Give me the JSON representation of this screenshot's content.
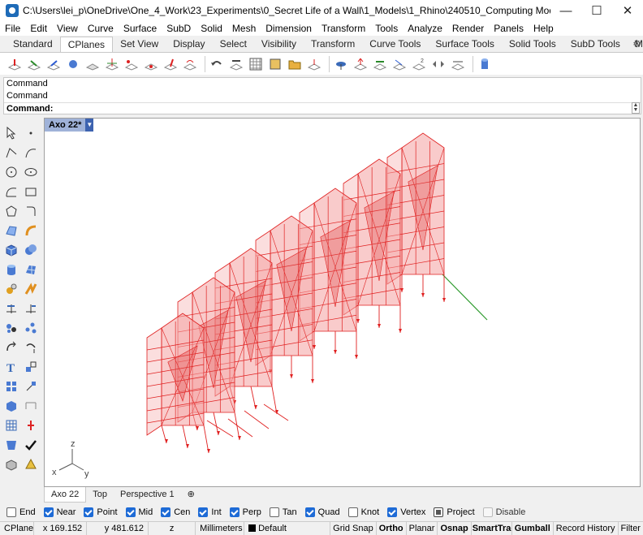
{
  "window": {
    "title": "C:\\Users\\lei_p\\OneDrive\\One_4_Work\\23_Experiments\\0_Secret Life of a Wall\\1_Models\\1_Rhino\\240510_Computing Module_Morphed Wall_...",
    "minimize": "—",
    "maximize": "☐",
    "close": "✕"
  },
  "menu": [
    "File",
    "Edit",
    "View",
    "Curve",
    "Surface",
    "SubD",
    "Solid",
    "Mesh",
    "Dimension",
    "Transform",
    "Tools",
    "Analyze",
    "Render",
    "Panels",
    "Help"
  ],
  "toolbar_tabs": [
    "Standard",
    "CPlanes",
    "Set View",
    "Display",
    "Select",
    "Visibility",
    "Transform",
    "Curve Tools",
    "Surface Tools",
    "Solid Tools",
    "SubD Tools",
    "Mesh To"
  ],
  "active_tab": "CPlanes",
  "command": {
    "history": [
      "Command",
      "Command"
    ],
    "prompt": "Command:"
  },
  "viewport": {
    "name": "Axo 22*",
    "axis_labels": {
      "x": "x",
      "y": "y",
      "z": "z"
    }
  },
  "viewport_tabs": [
    "Axo 22",
    "Top",
    "Perspective 1"
  ],
  "osnaps": [
    {
      "label": "End",
      "checked": false
    },
    {
      "label": "Near",
      "checked": true
    },
    {
      "label": "Point",
      "checked": true
    },
    {
      "label": "Mid",
      "checked": true
    },
    {
      "label": "Cen",
      "checked": true
    },
    {
      "label": "Int",
      "checked": true
    },
    {
      "label": "Perp",
      "checked": true
    },
    {
      "label": "Tan",
      "checked": false
    },
    {
      "label": "Quad",
      "checked": true
    },
    {
      "label": "Knot",
      "checked": false
    },
    {
      "label": "Vertex",
      "checked": true
    },
    {
      "label": "Project",
      "checked": false
    },
    {
      "label": "Disable",
      "checked": false
    }
  ],
  "status": {
    "cplane": "CPlane",
    "x": "x 169.152",
    "y": "y 481.612",
    "z": "z",
    "units": "Millimeters",
    "layer": "Default",
    "toggles": [
      "Grid Snap",
      "Ortho",
      "Planar",
      "Osnap",
      "SmartTrack",
      "Gumball",
      "Record History",
      "Filter"
    ],
    "bold_toggles": [
      "Ortho",
      "Osnap",
      "SmartTrack",
      "Gumball"
    ]
  },
  "colors": {
    "model_red": "#e02020",
    "model_fill": "#f4a0a0",
    "axis_green": "#2e9b2e",
    "viewport_label_bg": "#9fb2d8"
  }
}
